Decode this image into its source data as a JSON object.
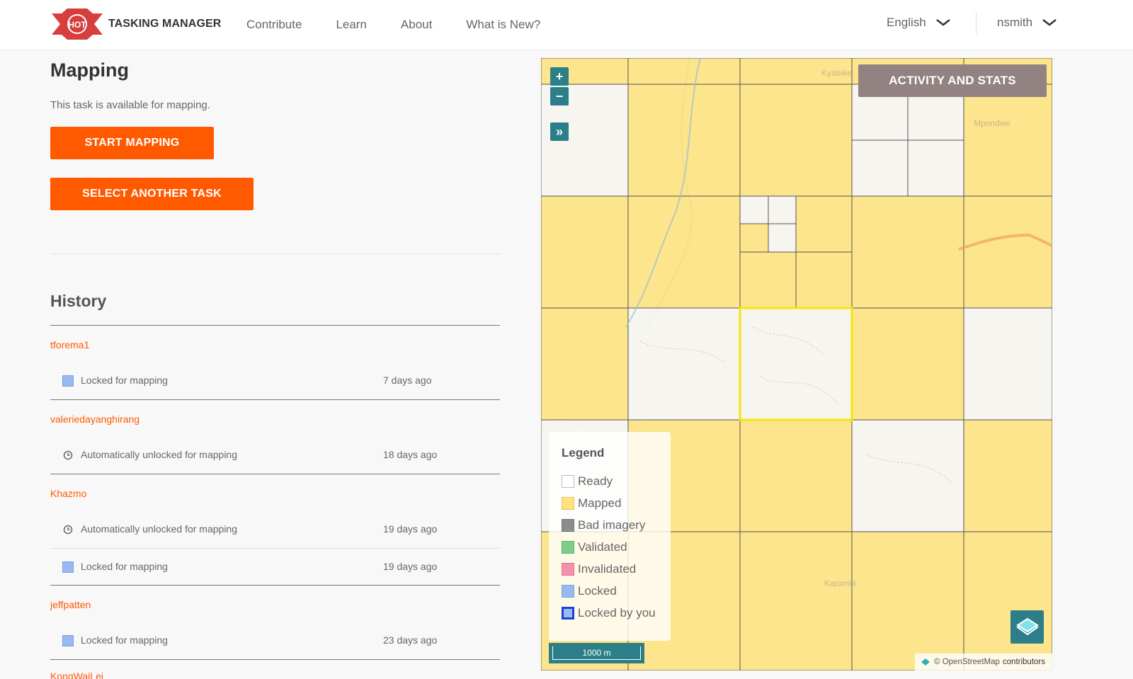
{
  "header": {
    "logo_badge": "HOT",
    "logo_text": "TASKING MANAGER",
    "nav": [
      "Contribute",
      "Learn",
      "About",
      "What is New?"
    ],
    "language": "English",
    "username": "nsmith"
  },
  "task_panel": {
    "title": "Mapping",
    "status_text": "This task is available for mapping.",
    "start_button": "START MAPPING",
    "select_button": "SELECT ANOTHER TASK"
  },
  "history": {
    "title": "History",
    "entries": [
      {
        "user": "tforema1",
        "events": [
          {
            "icon": "locked-square",
            "action": "Locked for mapping",
            "time": "7 days ago"
          }
        ]
      },
      {
        "user": "valeriedayanghirang",
        "events": [
          {
            "icon": "clock-icon",
            "action": "Automatically unlocked for mapping",
            "time": "18 days ago"
          }
        ]
      },
      {
        "user": "Khazmo",
        "events": [
          {
            "icon": "clock-icon",
            "action": "Automatically unlocked for mapping",
            "time": "19 days ago"
          },
          {
            "icon": "locked-square",
            "action": "Locked for mapping",
            "time": "19 days ago"
          }
        ]
      },
      {
        "user": "jeffpatten",
        "events": [
          {
            "icon": "locked-square",
            "action": "Locked for mapping",
            "time": "23 days ago"
          }
        ]
      },
      {
        "user": "KongWaiLei",
        "events": []
      }
    ]
  },
  "map": {
    "zoom_in": "+",
    "zoom_out": "−",
    "expand": "»",
    "activity_button": "ACTIVITY AND STATS",
    "place_labels": [
      "Kyabike",
      "Mpondwe",
      "Karambi"
    ],
    "scale_label": "1000 m",
    "attribution_prefix": "© OpenStreetMap",
    "attribution_link": "contributors",
    "legend": {
      "title": "Legend",
      "items": [
        {
          "label": "Ready",
          "color": "#ffffff",
          "border": "#bbbbbb"
        },
        {
          "label": "Mapped",
          "color": "#fde27e",
          "border": "#e8c45a"
        },
        {
          "label": "Bad imagery",
          "color": "#8c8c8c",
          "border": "#777777"
        },
        {
          "label": "Validated",
          "color": "#7fcc8a",
          "border": "#5fb26c"
        },
        {
          "label": "Invalidated",
          "color": "#f492ac",
          "border": "#e0728f"
        },
        {
          "label": "Locked",
          "color": "#9ab9f3",
          "border": "#7b9fe0"
        },
        {
          "label": "Locked by you",
          "color": "#9ab9f3",
          "border": "#1f3fd6"
        }
      ]
    }
  },
  "colors": {
    "accent": "#ff5a00",
    "map_button": "#2c7f88",
    "mapped": "#fde27e",
    "selected_outline": "#f4e60a"
  }
}
